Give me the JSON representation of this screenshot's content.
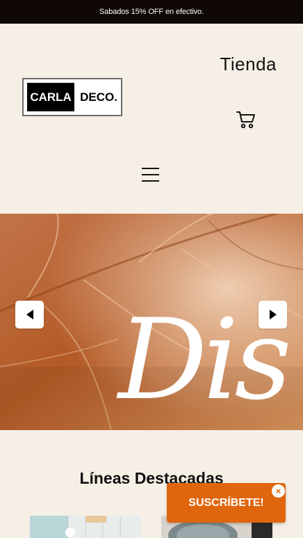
{
  "announcement": "Sabados 15% OFF en efectivo.",
  "logo": {
    "left": "CARLA",
    "right": "DECO."
  },
  "nav": {
    "shop_label": "Tienda"
  },
  "icons": {
    "cart": "cart-icon",
    "menu": "hamburger-menu-icon",
    "prev": "chevron-left-icon",
    "next": "chevron-right-icon",
    "close": "close-icon"
  },
  "hero": {
    "script_text": "Dis"
  },
  "section": {
    "title": "Líneas Destacadas"
  },
  "popup": {
    "subscribe_label": "SUSCRÍBETE!",
    "close_label": "×"
  },
  "colors": {
    "topbar": "#0f0806",
    "background": "#f5efe6",
    "accent": "#e0660d"
  }
}
